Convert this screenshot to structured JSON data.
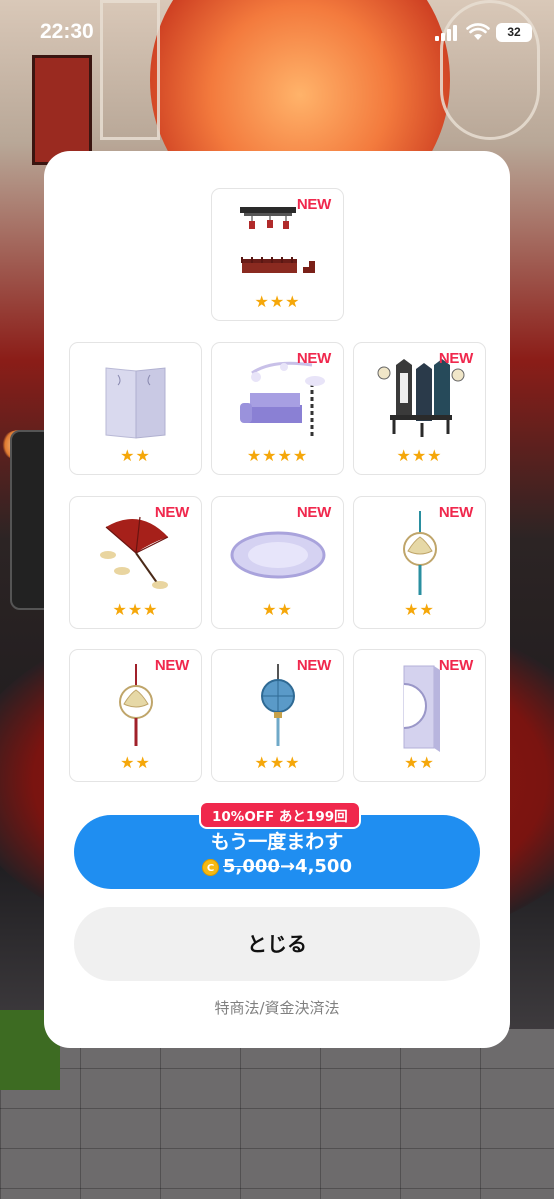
{
  "status_bar": {
    "time": "22:30",
    "battery": "32"
  },
  "items": [
    {
      "id": "ceiling-stairs",
      "new": "NEW",
      "stars": "★★★"
    },
    {
      "id": "partition",
      "new": "",
      "stars": "★★"
    },
    {
      "id": "sofa-set",
      "new": "NEW",
      "stars": "★★★★"
    },
    {
      "id": "chairs",
      "new": "NEW",
      "stars": "★★★"
    },
    {
      "id": "umbrella",
      "new": "NEW",
      "stars": "★★★"
    },
    {
      "id": "rug",
      "new": "NEW",
      "stars": "★★"
    },
    {
      "id": "lotus-ornament",
      "new": "NEW",
      "stars": "★★"
    },
    {
      "id": "lotus-red-ornament",
      "new": "NEW",
      "stars": "★★"
    },
    {
      "id": "blue-lantern",
      "new": "NEW",
      "stars": "★★★"
    },
    {
      "id": "round-window-panel",
      "new": "NEW",
      "stars": "★★"
    }
  ],
  "spin_again": {
    "badge": "10%OFF あと199回",
    "label": "もう一度まわす",
    "coin": "C",
    "old_price": "5,000",
    "arrow": "→",
    "new_price": "4,500"
  },
  "close_label": "とじる",
  "legal_link": "特商法/資金決済法",
  "colors": {
    "accent_blue": "#1f8ef1",
    "new_red": "#f0284d",
    "star": "#f5a70a"
  }
}
